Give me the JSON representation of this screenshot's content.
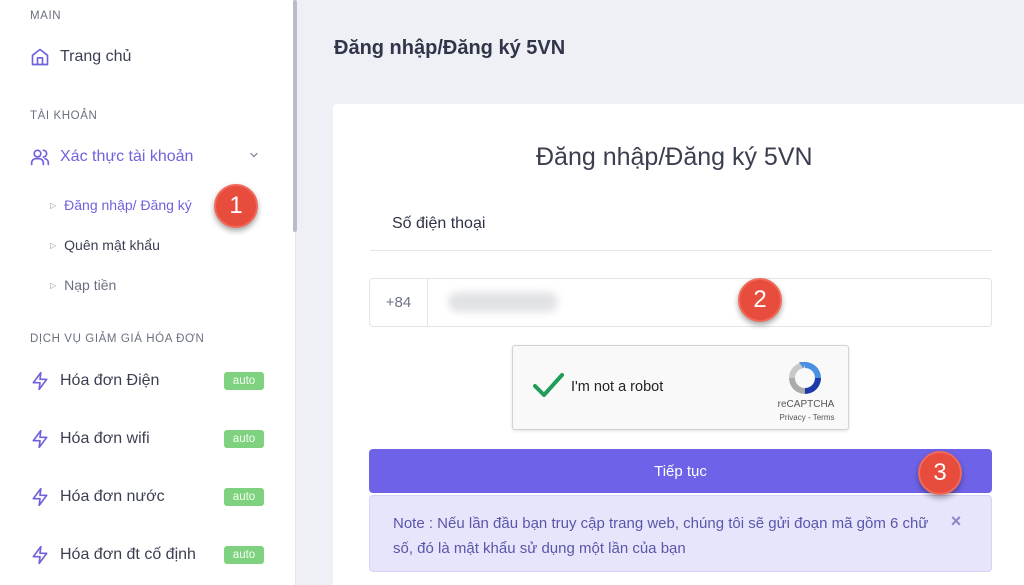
{
  "sidebar": {
    "sections": {
      "main": "MAIN",
      "account": "TÀI KHOẢN",
      "services": "DỊCH VỤ GIẢM GIÁ HÓA ĐƠN"
    },
    "home": {
      "label": "Trang chủ",
      "icon": "home-icon"
    },
    "auth": {
      "label": "Xác thực tài khoản",
      "icon": "users-icon"
    },
    "sub_items": [
      {
        "label": "Đăng nhập/ Đăng ký"
      },
      {
        "label": "Quên mật khẩu"
      },
      {
        "label": "Nạp tiền"
      }
    ],
    "services": [
      {
        "label": "Hóa đơn Điện",
        "badge": "auto"
      },
      {
        "label": "Hóa đơn wifi",
        "badge": "auto"
      },
      {
        "label": "Hóa đơn nước",
        "badge": "auto"
      },
      {
        "label": "Hóa đơn đt cố định",
        "badge": "auto"
      }
    ]
  },
  "page": {
    "title": "Đăng nhập/Đăng ký 5VN"
  },
  "form": {
    "heading": "Đăng nhập/Đăng ký 5VN",
    "phone_label": "Số điện thoại",
    "prefix": "+84",
    "captcha_text": "I'm not a robot",
    "captcha_brand": "reCAPTCHA",
    "captcha_links": "Privacy - Terms",
    "submit_label": "Tiếp tục",
    "note": "Note : Nếu lần đầu bạn truy cập trang web, chúng tôi sẽ gửi đoạn mã gồm 6 chữ số, đó là mật khẩu sử dụng một lần của bạn",
    "close_glyph": "×"
  },
  "markers": [
    "1",
    "2",
    "3"
  ],
  "colors": {
    "accent": "#6e63e8",
    "badge": "#7ed17e",
    "marker": "#e74c3c"
  }
}
